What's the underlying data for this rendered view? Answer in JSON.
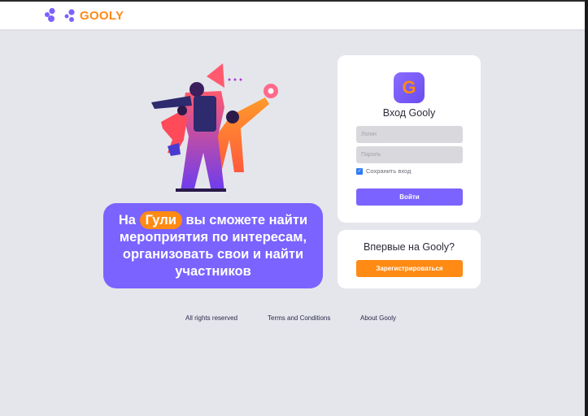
{
  "brand": {
    "name": "GOOLY",
    "accent_orange": "#ff8a14",
    "accent_purple": "#7a63ff"
  },
  "promo": {
    "line1_pre": "На",
    "line1_highlight": "Гули",
    "line1_post": "вы сможете найти",
    "line2": "мероприятия по интересам,",
    "line3": "организовать свои и найти",
    "line4": "участников"
  },
  "login": {
    "app_icon_letter": "G",
    "title": "Вход Gooly",
    "login_placeholder": "Логин",
    "password_placeholder": "Пароль",
    "remember_label": "Сохранить вход",
    "remember_checked": true,
    "submit_label": "Войти"
  },
  "register": {
    "title": "Впервые на Gooly?",
    "button_label": "Зарегистрироваться"
  },
  "footer": {
    "rights": "All rights reserved",
    "terms": "Terms and Conditions",
    "about": "About Gooly"
  }
}
